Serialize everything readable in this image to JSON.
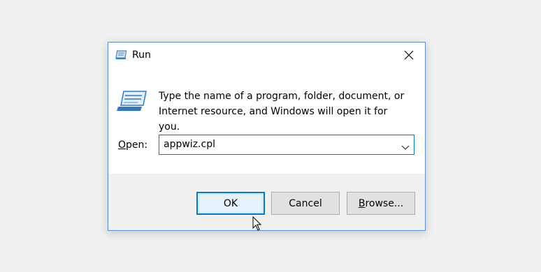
{
  "window": {
    "title": "Run",
    "close_icon": "close-icon"
  },
  "body": {
    "description_line1": "Type the name of a program, folder, document, or",
    "description_line2": "Internet resource, and Windows will open it for you.",
    "open_label_accel": "O",
    "open_label_rest": "pen:",
    "open_value": "appwiz.cpl"
  },
  "buttons": {
    "ok": "OK",
    "cancel": "Cancel",
    "browse_accel": "B",
    "browse_rest": "rowse..."
  },
  "colors": {
    "accent": "#0078d7",
    "border": "#5b8fd6",
    "footer": "#f0f0f0"
  }
}
